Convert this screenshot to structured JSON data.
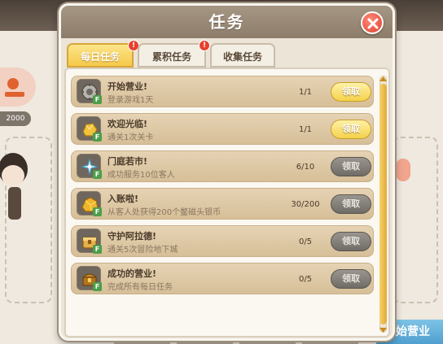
{
  "dialog": {
    "title": "任务",
    "close_icon": "close-icon"
  },
  "tabs": [
    {
      "label": "每日任务",
      "active": true,
      "badge": "!"
    },
    {
      "label": "累积任务",
      "active": false,
      "badge": "!"
    },
    {
      "label": "收集任务",
      "active": false,
      "badge": ""
    }
  ],
  "tasks": [
    {
      "title": "开始营业!",
      "desc": "登录游戏1天",
      "progress": "1/1",
      "button": "领取",
      "claimable": true,
      "icon": "gear-coin-icon"
    },
    {
      "title": "欢迎光临!",
      "desc": "通关1次关卡",
      "progress": "1/1",
      "button": "领取",
      "claimable": true,
      "icon": "gold-nugget-icon"
    },
    {
      "title": "门庭若市!",
      "desc": "成功服务10位客人",
      "progress": "6/10",
      "button": "领取",
      "claimable": false,
      "icon": "sparkle-crystal-icon"
    },
    {
      "title": "入账啦!",
      "desc": "从客人处获得200个鳖磁头银币",
      "progress": "30/200",
      "button": "领取",
      "claimable": false,
      "icon": "gold-ore-icon"
    },
    {
      "title": "守护阿拉德!",
      "desc": "通关5次冒险地下城",
      "progress": "0/5",
      "button": "领取",
      "claimable": false,
      "icon": "treasure-box-icon"
    },
    {
      "title": "成功的营业!",
      "desc": "完成所有每日任务",
      "progress": "0/5",
      "button": "领取",
      "claimable": false,
      "icon": "treasure-chest-icon"
    }
  ],
  "background": {
    "left_count": "2000",
    "bottom_right_text": "开始营业"
  },
  "colors": {
    "accent_yellow": "#f4d24a",
    "row_tan": "#d6bf98",
    "title_brown": "#8d7c6a",
    "disabled_gray": "#6f6b65",
    "badge_red": "#e8402e"
  }
}
